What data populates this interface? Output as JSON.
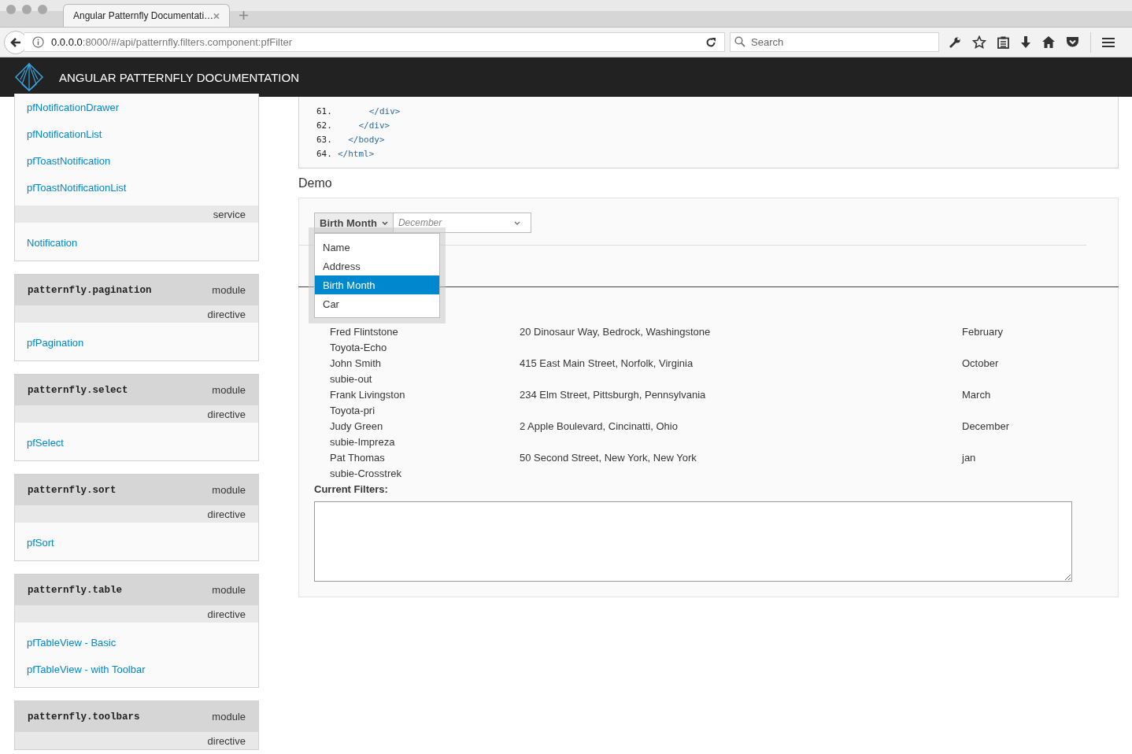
{
  "browser": {
    "tab_title": "Angular Patternfly Documentati…",
    "url_host": "0.0.0.0",
    "url_rest": ":8000/#/api/patternfly.filters.component:pfFilter",
    "search": {
      "placeholder": "Search"
    }
  },
  "header": {
    "title": "ANGULAR PATTERNFLY DOCUMENTATION"
  },
  "sidebar": [
    {
      "sections": [
        {
          "links": [
            "pfNotificationDrawer",
            "pfNotificationList",
            "pfToastNotification",
            "pfToastNotificationList"
          ]
        },
        {
          "type": "service",
          "links": [
            "Notification"
          ]
        }
      ]
    },
    {
      "module": "patternfly.pagination",
      "module_label": "module",
      "sections": [
        {
          "type": "directive",
          "links": [
            "pfPagination"
          ]
        }
      ]
    },
    {
      "module": "patternfly.select",
      "module_label": "module",
      "sections": [
        {
          "type": "directive",
          "links": [
            "pfSelect"
          ]
        }
      ]
    },
    {
      "module": "patternfly.sort",
      "module_label": "module",
      "sections": [
        {
          "type": "directive",
          "links": [
            "pfSort"
          ]
        }
      ]
    },
    {
      "module": "patternfly.table",
      "module_label": "module",
      "sections": [
        {
          "type": "directive",
          "links": [
            "pfTableView - Basic",
            "pfTableView - with Toolbar"
          ]
        }
      ]
    },
    {
      "module": "patternfly.toolbars",
      "module_label": "module",
      "sections": [
        {
          "type": "directive"
        }
      ]
    }
  ],
  "code": [
    {
      "number": "61.",
      "text": "      </div>"
    },
    {
      "number": "62.",
      "text": "    </div>"
    },
    {
      "number": "63.",
      "text": "  </body>"
    },
    {
      "number": "64.",
      "text": "</html>"
    }
  ],
  "demo": {
    "heading": "Demo",
    "filter": {
      "field": "Birth Month",
      "value": {
        "placeholder": "December"
      },
      "options": [
        {
          "label": "Name",
          "selected": false
        },
        {
          "label": "Address",
          "selected": false
        },
        {
          "label": "Birth Month",
          "selected": true
        },
        {
          "label": "Car",
          "selected": false
        }
      ]
    },
    "rows": [
      {
        "name": "Fred Flintstone",
        "car": "Toyota-Echo",
        "address": "20 Dinosaur Way, Bedrock, Washingstone",
        "month": "February"
      },
      {
        "name": "John Smith",
        "car": "subie-out",
        "address": "415 East Main Street, Norfolk, Virginia",
        "month": "October"
      },
      {
        "name": "Frank Livingston",
        "car": "Toyota-pri",
        "address": "234 Elm Street, Pittsburgh, Pennsylvania",
        "month": "March"
      },
      {
        "name": "Judy Green",
        "car": "subie-Impreza",
        "address": "2 Apple Boulevard, Cincinatti, Ohio",
        "month": "December"
      },
      {
        "name": "Pat Thomas",
        "car": "subie-Crosstrek",
        "address": "50 Second Street, New York, New York",
        "month": "jan"
      }
    ],
    "current_filters_label": "Current Filters:"
  }
}
